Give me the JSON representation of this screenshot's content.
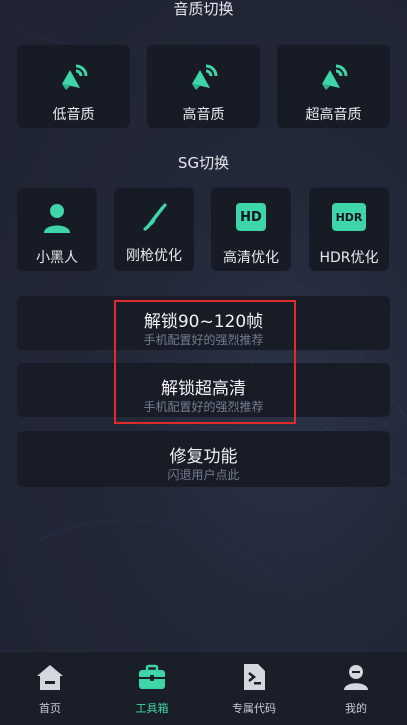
{
  "quality": {
    "title": "音质切换",
    "items": [
      {
        "label": "低音质",
        "icon": "speaker-icon"
      },
      {
        "label": "高音质",
        "icon": "speaker-icon"
      },
      {
        "label": "超高音质",
        "icon": "speaker-icon"
      }
    ]
  },
  "sg": {
    "title": "SG切换",
    "items": [
      {
        "label": "小黑人",
        "icon": "person-icon"
      },
      {
        "label": "刚枪优化",
        "icon": "rifle-icon"
      },
      {
        "label": "高清优化",
        "icon": "hd-icon",
        "badge": "HD"
      },
      {
        "label": "HDR优化",
        "icon": "hdr-icon",
        "badge": "HDR"
      }
    ]
  },
  "actions": [
    {
      "title": "解锁90~120帧",
      "subtitle": "手机配置好的强烈推荐"
    },
    {
      "title": "解锁超高清",
      "subtitle": "手机配置好的强烈推荐"
    },
    {
      "title": "修复功能",
      "subtitle": "闪退用户点此"
    }
  ],
  "nav": [
    {
      "label": "首页",
      "icon": "home-icon",
      "active": false
    },
    {
      "label": "工具箱",
      "icon": "toolbox-icon",
      "active": true
    },
    {
      "label": "专属代码",
      "icon": "code-file-icon",
      "active": false
    },
    {
      "label": "我的",
      "icon": "profile-icon",
      "active": false
    }
  ],
  "colors": {
    "accent": "#3ed6a8",
    "highlight": "#e02b2b",
    "card": "#171b26"
  }
}
